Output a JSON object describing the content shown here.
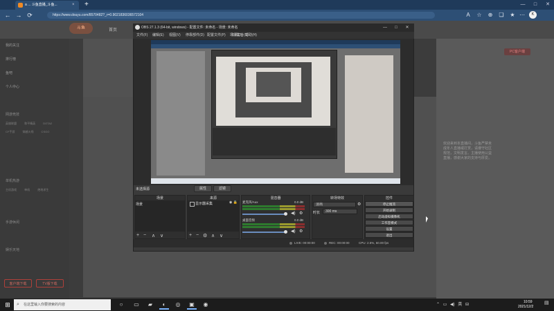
{
  "browser": {
    "tab_title": "a ... 斗鱼直播_斗鱼...",
    "tab_close": "×",
    "new_tab": "+",
    "address": "https://www.douyu.com/8570482?_r=0.9021836036572104",
    "min": "—",
    "max": "□",
    "close": "✕",
    "profile_initial": "K",
    "back": "←",
    "forward": "→",
    "refresh": "⟳"
  },
  "douyu": {
    "logo": "斗鱼",
    "nav_home": "首页",
    "sidebar_items": [
      "我的关注",
      "排行榜",
      "鱼吧",
      "个人中心"
    ],
    "sidebar_sections": [
      "网游竞技",
      "单机热游",
      "手游休闲",
      "娱乐天地"
    ],
    "sidebar_grid": [
      "英雄联盟 和平精英 DOTA2",
      "CF手游 穿越火线 CSGO",
      "主机游戏 单机 绝地求生"
    ],
    "sidebar_btn_1": "客户端下载",
    "sidebar_btn_2": "TV版下载",
    "pc_badge": "PC客户端",
    "chat_lines": [
      "欢迎来到本直播间，斗鱼严禁未",
      "成年人直播或打赏，请遵守社区",
      "规范，文明发言。主播使用公益",
      "直播，感谢大家的支持与厚爱。"
    ]
  },
  "obs": {
    "title": "OBS 27.1.3 (64-bit, windows) - 配置文件: 未命名 - 场景: 未命名",
    "menu": [
      "文件(F)",
      "编辑(E)",
      "视图(V)",
      "停靠部件(D)",
      "配置文件(P)",
      "场景集合(S)",
      "工具(T)",
      "帮助(H)"
    ],
    "current_scene_label": "未选择源",
    "filter_btn": "属性",
    "filter_btn2": "滤镜",
    "docks": {
      "scenes": "场景",
      "sources": "来源",
      "mixer": "混音器",
      "transitions": "转场特效",
      "controls": "控件"
    },
    "scene_item": "场景",
    "source_item": "显示器采集",
    "mixer": [
      {
        "name": "麦克风/Aux",
        "db": "0.0 dB"
      },
      {
        "name": "桌面音频",
        "db": "0.0 dB"
      }
    ],
    "transition": "淡出",
    "duration_label": "时长",
    "duration": "300 ms",
    "controls": [
      "停止推流",
      "开始录制",
      "启动虚拟摄像机",
      "工作室模式",
      "设置",
      "退出"
    ],
    "status": {
      "live": "LIVE: 00:00:00",
      "rec": "REC: 00:00:00",
      "cpu": "CPU: 2.5%, 60.00 fps"
    }
  },
  "taskbar": {
    "search_placeholder": "在这里输入你要搜索的内容",
    "time": "10:59",
    "date": "2021/12/2"
  }
}
